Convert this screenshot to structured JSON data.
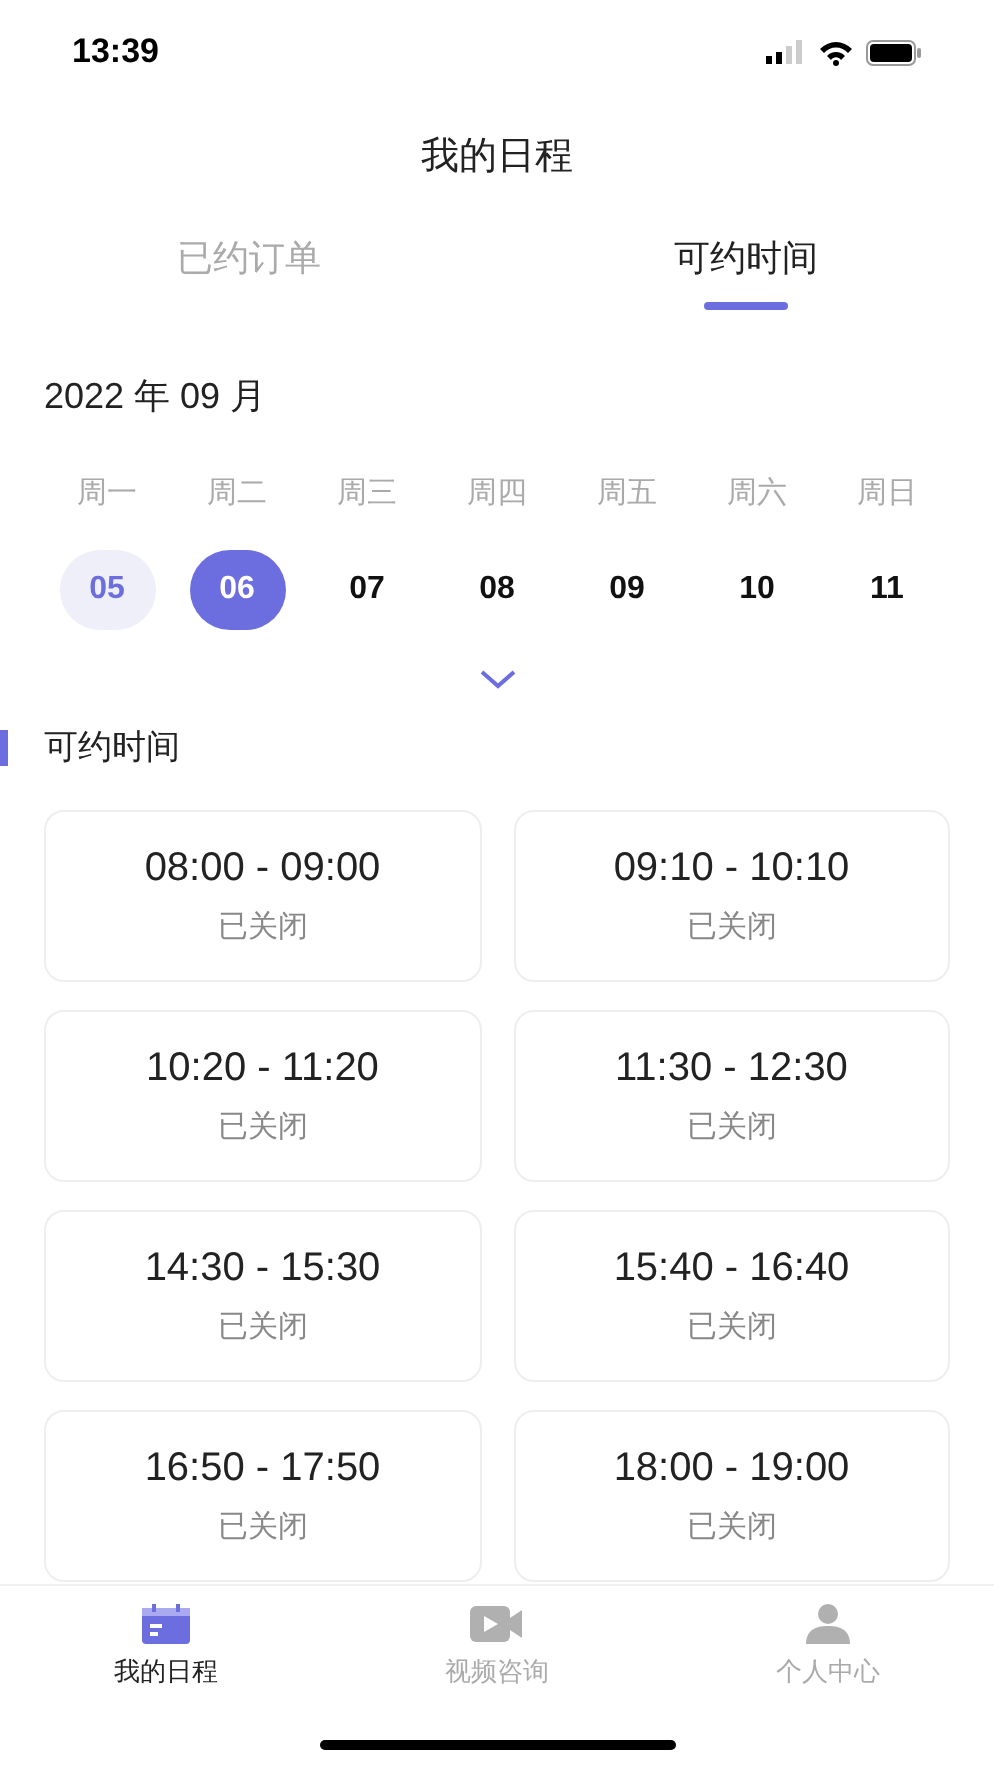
{
  "status_bar": {
    "time": "13:39"
  },
  "title": "我的日程",
  "tabs": [
    {
      "label": "已约订单",
      "selected": false
    },
    {
      "label": "可约时间",
      "selected": true
    }
  ],
  "month": "2022 年 09 月",
  "weekdays": [
    "周一",
    "周二",
    "周三",
    "周四",
    "周五",
    "周六",
    "周日"
  ],
  "days": [
    {
      "label": "05",
      "today": true,
      "selected": false
    },
    {
      "label": "06",
      "today": false,
      "selected": true
    },
    {
      "label": "07",
      "today": false,
      "selected": false
    },
    {
      "label": "08",
      "today": false,
      "selected": false
    },
    {
      "label": "09",
      "today": false,
      "selected": false
    },
    {
      "label": "10",
      "today": false,
      "selected": false
    },
    {
      "label": "11",
      "today": false,
      "selected": false
    }
  ],
  "section_title": "可约时间",
  "slots": [
    {
      "time": "08:00 - 09:00",
      "status": "已关闭"
    },
    {
      "time": "09:10 - 10:10",
      "status": "已关闭"
    },
    {
      "time": "10:20 - 11:20",
      "status": "已关闭"
    },
    {
      "time": "11:30 - 12:30",
      "status": "已关闭"
    },
    {
      "time": "14:30 - 15:30",
      "status": "已关闭"
    },
    {
      "time": "15:40 - 16:40",
      "status": "已关闭"
    },
    {
      "time": "16:50 - 17:50",
      "status": "已关闭"
    },
    {
      "time": "18:00 - 19:00",
      "status": "已关闭"
    }
  ],
  "bottom_nav": [
    {
      "label": "我的日程",
      "kind": "calendar",
      "selected": true
    },
    {
      "label": "视频咨询",
      "kind": "video",
      "selected": false
    },
    {
      "label": "个人中心",
      "kind": "person",
      "selected": false
    }
  ]
}
